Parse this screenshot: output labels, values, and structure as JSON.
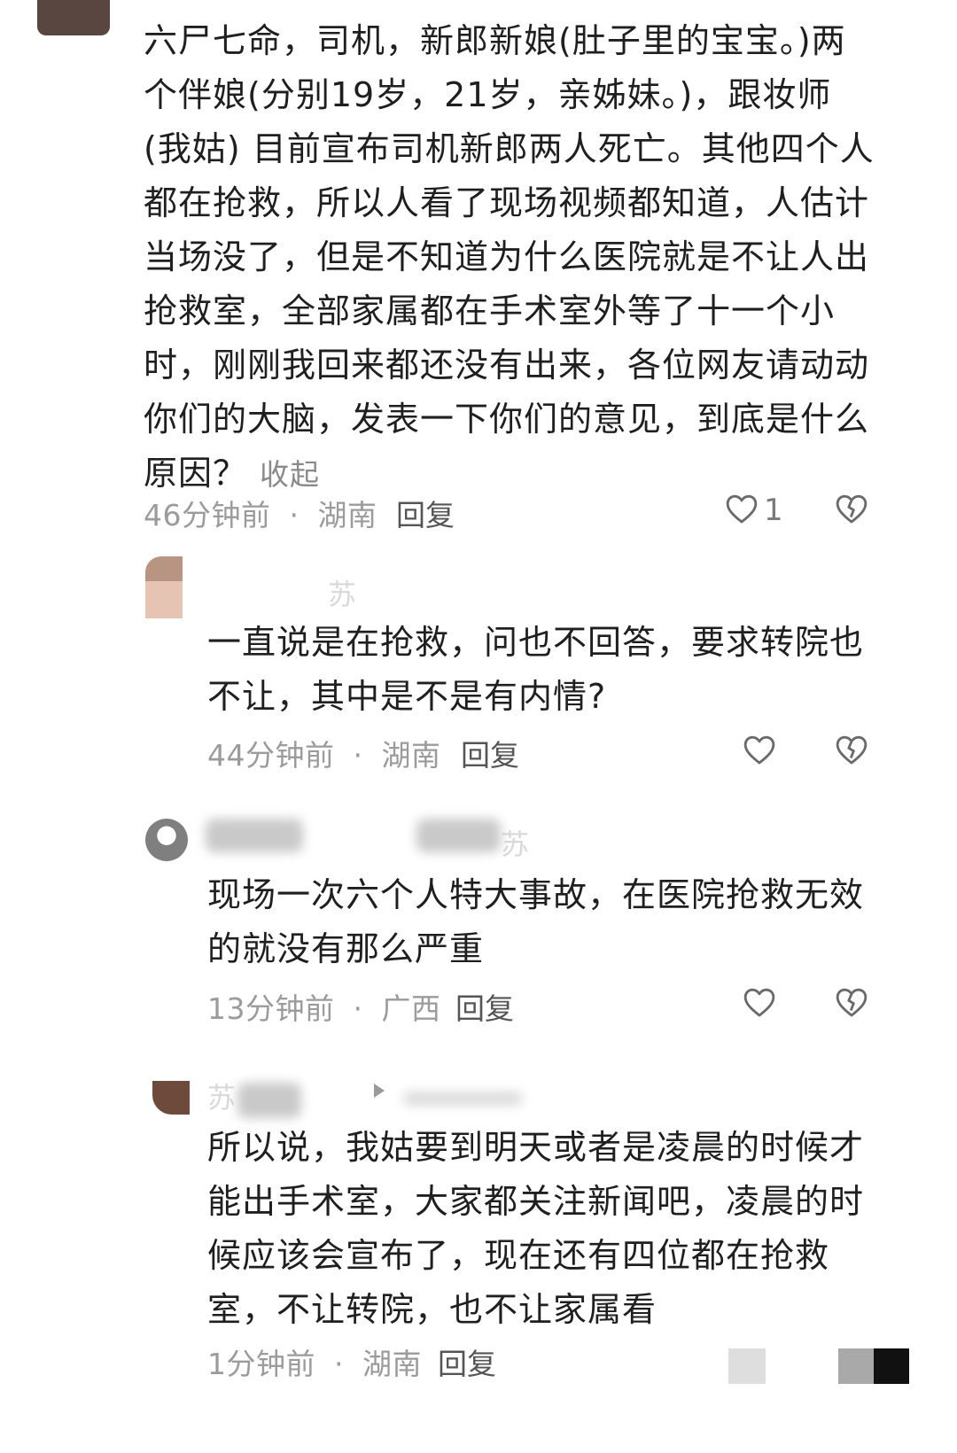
{
  "comments": [
    {
      "text": "六尸七命，司机，新郎新娘(肚子里的宝宝。)两个伴娘(分别19岁，21岁，亲姊妹。)，跟妆师(我姑) 目前宣布司机新郎两人死亡。其他四个人都在抢救，所以人看了现场视频都知道，人估计当场没了，但是不知道为什么医院就是不让人出抢救室，全部家属都在手术室外等了十一个小时，刚刚我回来都还没有出来，各位网友请动动你们的大脑，发表一下你们的意见，到底是什么原因？",
      "collapse_label": "收起",
      "time": "46分钟前",
      "location": "湖南",
      "reply_label": "回复",
      "like_count": "1"
    },
    {
      "name_fragment": "苏",
      "text": "一直说是在抢救，问也不回答，要求转院也不让，其中是不是有内情?",
      "time": "44分钟前",
      "location": "湖南",
      "reply_label": "回复"
    },
    {
      "name_fragment": "苏",
      "text": "现场一次六个人特大事故，在医院抢救无效的就没有那么严重",
      "time": "13分钟前",
      "location": "广西",
      "reply_label": "回复"
    },
    {
      "name_fragment": "苏",
      "text": "所以说，我姑要到明天或者是凌晨的时候才能出手术室，大家都关注新闻吧，凌晨的时候应该会宣布了，现在还有四位都在抢救室，不让转院，也不让家属看",
      "time": "1分钟前",
      "location": "湖南",
      "reply_label": "回复"
    }
  ],
  "separator": "·",
  "colors": {
    "text": "#1f1f1f",
    "meta": "#9b9b9b",
    "icon": "#666666"
  },
  "icons": [
    "heart-icon",
    "broken-heart-icon",
    "play-triangle-icon"
  ]
}
